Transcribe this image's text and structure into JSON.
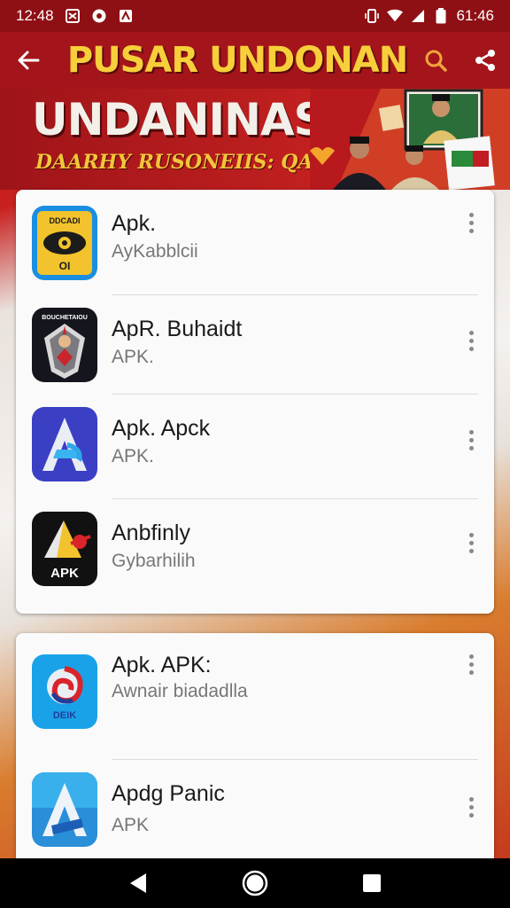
{
  "status_bar": {
    "time_left": "12:48",
    "time_right": "61:46"
  },
  "app_bar": {
    "title": "PUSAR UNDONAN"
  },
  "banner": {
    "title": "UNDANINASIA",
    "subtitle": "DAARHY RUSONEIIS: QACIIK"
  },
  "list_card_1": [
    {
      "name": "Apk.",
      "sub": "AyKabblcii",
      "icon": "eye-badge-icon"
    },
    {
      "name": "ApR. Buhaidt",
      "sub": "APK.",
      "icon": "warrior-shield-icon"
    },
    {
      "name": "Apk. Apck",
      "sub": "APK.",
      "icon": "letter-a-icon"
    },
    {
      "name": "Anbfinly",
      "sub": "Gybarhilih",
      "icon": "apk-pen-icon"
    }
  ],
  "list_card_2": [
    {
      "name": "Apk. APK:",
      "sub": "Awnair biadadlla",
      "icon": "swirl-badge-icon"
    },
    {
      "name": "Apdg Panic",
      "sub": "APK",
      "icon": "letter-a-blue-icon"
    }
  ],
  "icon_labels": {
    "eye_top": "DDCADI",
    "eye_bottom": "OI",
    "warrior_top": "BOUCHETAIOU",
    "apk_text": "APK",
    "swirl_text": "DEIK"
  },
  "colors": {
    "status_bar": "#8e1015",
    "app_bar": "#a3151b",
    "title_yellow": "#f6cf3a",
    "card": "#fafafa",
    "nav_bar": "#000000"
  }
}
